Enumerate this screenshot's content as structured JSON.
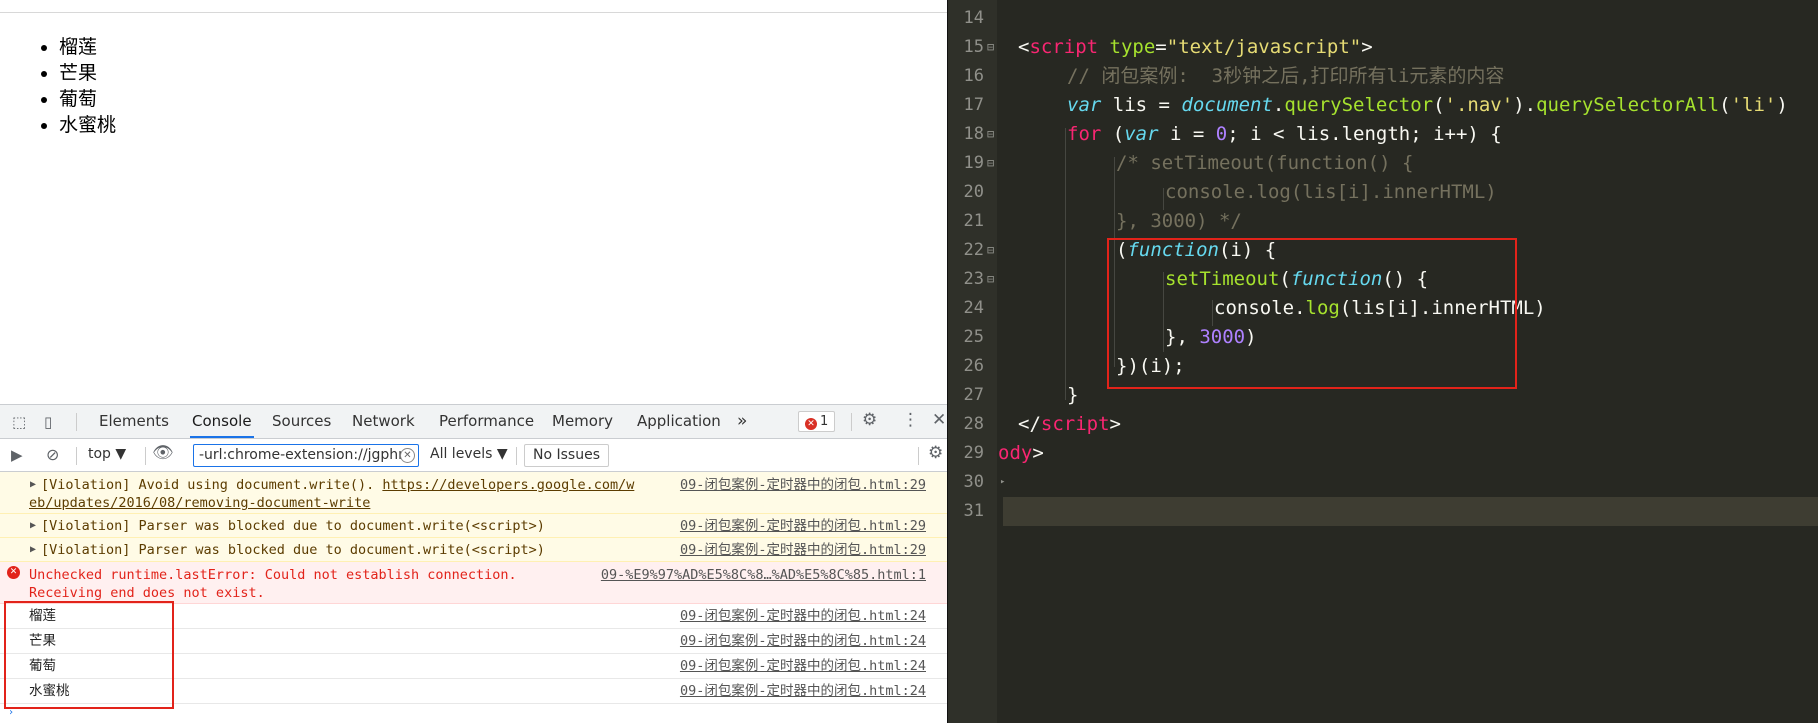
{
  "page": {
    "list_items": [
      "榴莲",
      "芒果",
      "葡萄",
      "水蜜桃"
    ]
  },
  "devtools": {
    "tabs": [
      "Elements",
      "Console",
      "Sources",
      "Network",
      "Performance",
      "Memory",
      "Application"
    ],
    "active_tab": "Console",
    "more_tabs": "»",
    "error_count": "1",
    "context": "top",
    "filter_value": "-url:chrome-extension://jgphn",
    "levels": "All levels",
    "no_issues": "No Issues",
    "messages": [
      {
        "type": "warn",
        "text": "[Violation] Avoid using document.write(). ",
        "link": "https://developers.google.com/w",
        "link2": "eb/updates/2016/08/removing-document-write",
        "source": "09-闭包案例-定时器中的闭包.html:29"
      },
      {
        "type": "warn",
        "text": "[Violation] Parser was blocked due to document.write(<script>)",
        "source": "09-闭包案例-定时器中的闭包.html:29"
      },
      {
        "type": "warn",
        "text": "[Violation] Parser was blocked due to document.write(<script>)",
        "source": "09-闭包案例-定时器中的闭包.html:29"
      },
      {
        "type": "error",
        "text": "Unchecked runtime.lastError: Could not establish connection.",
        "text2": "Receiving end does not exist.",
        "source": "09-%E9%97%AD%E5%8C%8…%AD%E5%8C%85.html:1"
      },
      {
        "type": "log",
        "text": "榴莲",
        "source": "09-闭包案例-定时器中的闭包.html:24"
      },
      {
        "type": "log",
        "text": "芒果",
        "source": "09-闭包案例-定时器中的闭包.html:24"
      },
      {
        "type": "log",
        "text": "葡萄",
        "source": "09-闭包案例-定时器中的闭包.html:24"
      },
      {
        "type": "log",
        "text": "水蜜桃",
        "source": "09-闭包案例-定时器中的闭包.html:24"
      }
    ]
  },
  "editor": {
    "line_numbers": [
      "14",
      "15",
      "16",
      "17",
      "18",
      "19",
      "20",
      "21",
      "22",
      "23",
      "24",
      "25",
      "26",
      "27",
      "28",
      "29",
      "30",
      "31"
    ],
    "code": {
      "l15_open": "<",
      "l15_tag": "script",
      "l15_attr": " type",
      "l15_eq": "=",
      "l15_val": "\"text/javascript\"",
      "l15_close": ">",
      "l16": "// 闭包案例:  3秒钟之后,打印所有li元素的内容",
      "l17_var": "var",
      "l17_a": " lis = ",
      "l17_doc": "document",
      "l17_b": ".",
      "l17_qs": "querySelector",
      "l17_c": "(",
      "l17_s1": "'.nav'",
      "l17_d": ").",
      "l17_qsa": "querySelectorAll",
      "l17_e": "(",
      "l17_s2": "'li'",
      "l17_f": ")",
      "l18_for": "for",
      "l18_a": " (",
      "l18_var": "var",
      "l18_b": " i = ",
      "l18_zero": "0",
      "l18_c": "; i < lis.length; i++) {",
      "l19": "/* setTimeout(function() {",
      "l20": "console.log(lis[i].innerHTML)",
      "l21": "}, 3000) */",
      "l22_a": "(",
      "l22_fn": "function",
      "l22_b": "(i) {",
      "l23_st": "setTimeout",
      "l23_a": "(",
      "l23_fn": "function",
      "l23_b": "() {",
      "l24_a": "console.",
      "l24_log": "log",
      "l24_b": "(lis[i].innerHTML)",
      "l25_a": "}, ",
      "l25_num": "3000",
      "l25_b": ")",
      "l26": "})(i);",
      "l27": "}",
      "l28_open": "</",
      "l28_tag": "script",
      "l28_close": ">",
      "l29_tag": "ody",
      "l29_close": ">"
    }
  }
}
